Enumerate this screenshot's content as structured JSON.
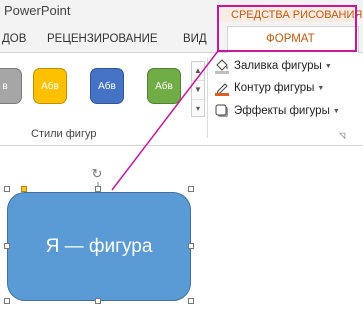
{
  "app": {
    "title": "PowerPoint"
  },
  "contextual": {
    "title": "СРЕДСТВА РИСОВАНИЯ",
    "accent_color": "#c55a11",
    "highlight_color": "#c8189f"
  },
  "tabs": [
    {
      "label": "ДОВ"
    },
    {
      "label": "РЕЦЕНЗИРОВАНИЕ"
    },
    {
      "label": "ВИД"
    },
    {
      "label": "ФОРМАТ",
      "active": true
    }
  ],
  "ribbon": {
    "shape_styles": {
      "group_label": "Стили фигур",
      "thumbnails": [
        {
          "label": "в",
          "color": "#a6a6a6"
        },
        {
          "label": "Абв",
          "color": "#ffc000"
        },
        {
          "label": "Абв",
          "color": "#4472c4"
        },
        {
          "label": "Абв",
          "color": "#70ad47"
        }
      ],
      "commands": [
        {
          "label": "Заливка фигуры",
          "icon": "paint-bucket-icon"
        },
        {
          "label": "Контур фигуры",
          "icon": "pen-outline-icon"
        },
        {
          "label": "Эффекты фигуры",
          "icon": "shape-effects-icon"
        }
      ]
    }
  },
  "slide": {
    "shape_text": "Я — фигура",
    "shape_color": "#5b9bd5"
  }
}
